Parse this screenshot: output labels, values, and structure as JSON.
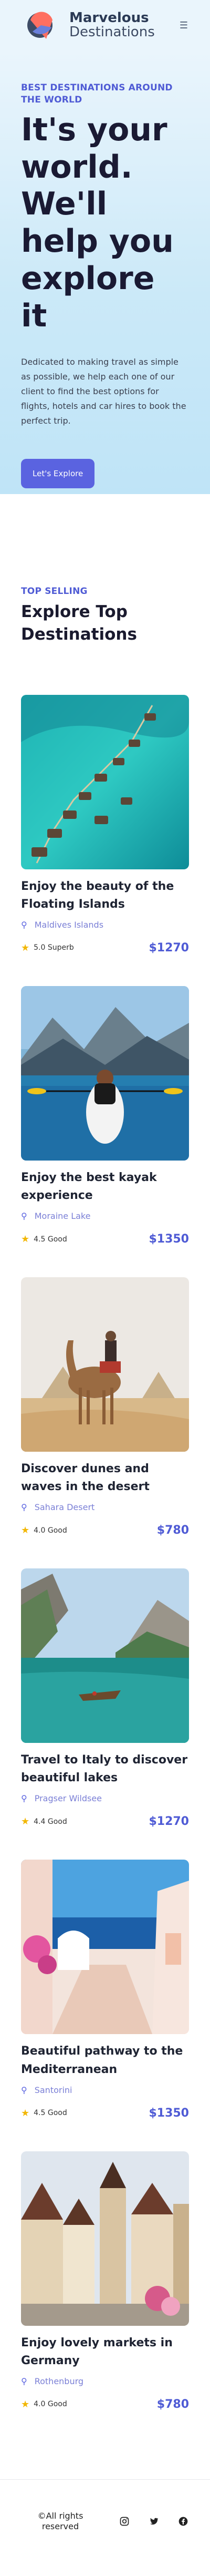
{
  "header": {
    "brand_name": "Marvelous",
    "brand_sub": "Destinations",
    "menu_icon": "hamburger-menu-icon"
  },
  "hero": {
    "eyebrow": "BEST DESTINATIONS AROUND THE WORLD",
    "title": "It's your world. We'll help you explore it",
    "description": "Dedicated to making travel as simple as possible, we help each one of our client to find the best options for flights, hotels and car hires to book the perfect trip.",
    "cta_label": "Let's Explore"
  },
  "destinations": {
    "eyebrow": "TOP SELLING",
    "title": "Explore Top Destinations",
    "cards": [
      {
        "title": "Enjoy the beauty of the Floating Islands",
        "location": "Maldives Islands",
        "rating": "5.0 Superb",
        "price": "$1270"
      },
      {
        "title": "Enjoy the best kayak experience",
        "location": "Moraine Lake",
        "rating": "4.5 Good",
        "price": "$1350"
      },
      {
        "title": "Discover dunes and waves in the desert",
        "location": "Sahara Desert",
        "rating": "4.0 Good",
        "price": "$780"
      },
      {
        "title": "Travel to Italy to discover beautiful lakes",
        "location": "Pragser Wildsee",
        "rating": "4.4 Good",
        "price": "$1270"
      },
      {
        "title": "Beautiful pathway to the Mediterranean",
        "location": "Santorini",
        "rating": "4.5 Good",
        "price": "$1350"
      },
      {
        "title": "Enjoy lovely markets in Germany",
        "location": "Rothenburg",
        "rating": "4.0 Good",
        "price": "$780"
      }
    ]
  },
  "footer": {
    "copyright": "©All rights reserved",
    "socials": [
      "instagram-icon",
      "twitter-icon",
      "facebook-icon"
    ]
  },
  "colors": {
    "accent": "#5a63e0",
    "price": "#4f5bd5",
    "star": "#f2b705"
  }
}
